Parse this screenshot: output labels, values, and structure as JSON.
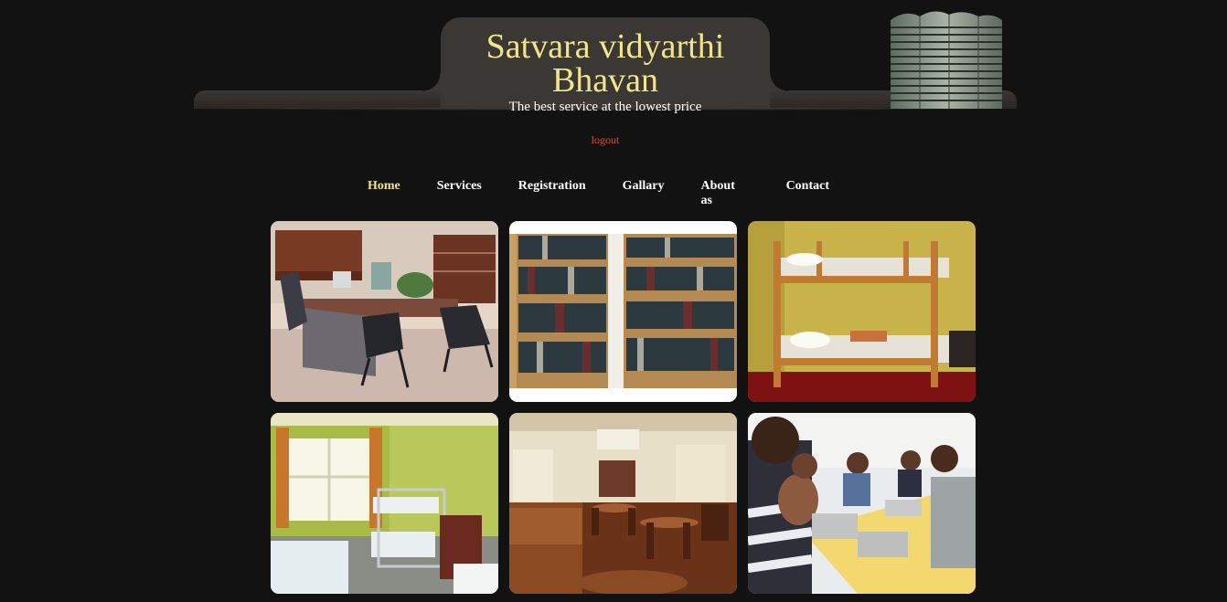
{
  "site": {
    "title": "Satvara vidyarthi Bhavan",
    "tagline": "The best service at the lowest price",
    "logout_label": "logout"
  },
  "nav": {
    "items": [
      {
        "label": "Home",
        "active": true
      },
      {
        "label": "Services",
        "active": false
      },
      {
        "label": "Registration",
        "active": false
      },
      {
        "label": "Gallary",
        "active": false
      },
      {
        "label": "About as",
        "active": false
      },
      {
        "label": "Contact",
        "active": false
      }
    ]
  },
  "colors": {
    "background": "#131212",
    "title": "#f1e58a",
    "logout": "#e04b2b",
    "nav_active": "#f1e58a",
    "nav_text": "#ffffff"
  },
  "gallery": {
    "images": [
      {
        "name": "office-room-photo"
      },
      {
        "name": "library-bookshelves-photo"
      },
      {
        "name": "bunk-bed-room-photo"
      },
      {
        "name": "dormitory-room-photo"
      },
      {
        "name": "dining-hall-photo"
      },
      {
        "name": "students-dining-photo"
      }
    ]
  }
}
